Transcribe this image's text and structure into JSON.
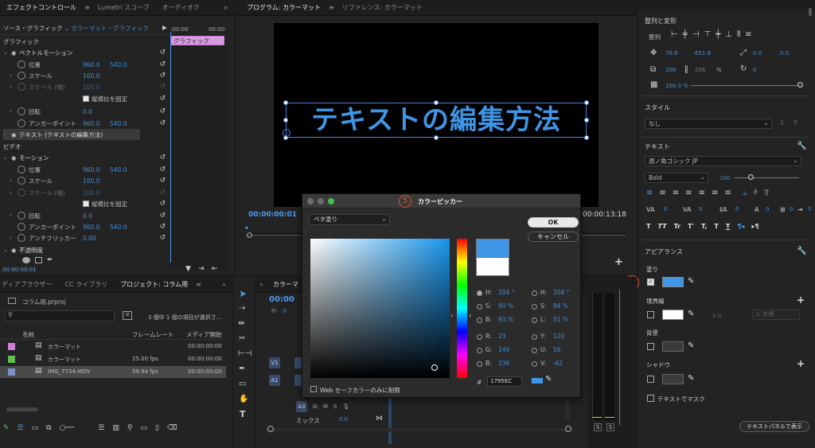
{
  "effect_controls": {
    "tab": "エフェクトコントロール",
    "tab_menu": "≡",
    "tab2": "Lumetri スコープ",
    "tab3": "オーディオク",
    "overflow": "»",
    "source_label": "ソース・グラフィック",
    "source_clip": "カラーマット・グラフィック",
    "timecode_start": ":00:00",
    "timecode_mid": "00:00",
    "clip_label": "グラフィック",
    "rows": [
      {
        "label": "グラフィック",
        "type": "section"
      },
      {
        "label": "ベクトルモーション",
        "type": "group"
      },
      {
        "label": "位置",
        "v1": "960.0",
        "v2": "540.0"
      },
      {
        "label": "スケール",
        "v1": "100.0"
      },
      {
        "label": "スケール (幅)",
        "v1": "100.0",
        "disabled": true
      },
      {
        "label": "縦横比を固定",
        "type": "checkbox"
      },
      {
        "label": "回転",
        "v1": "0.0"
      },
      {
        "label": "アンカーポイント",
        "v1": "960.0",
        "v2": "540.0"
      },
      {
        "label": "テキスト (テキストの編集方法)",
        "type": "group-selected"
      },
      {
        "label": "ビデオ",
        "type": "section"
      },
      {
        "label": "モーション",
        "type": "group"
      },
      {
        "label": "位置",
        "v1": "960.0",
        "v2": "540.0"
      },
      {
        "label": "スケール",
        "v1": "100.0"
      },
      {
        "label": "スケール (幅)",
        "v1": "100.0",
        "disabled": true
      },
      {
        "label": "縦横比を固定",
        "type": "checkbox"
      },
      {
        "label": "回転",
        "v1": "0.0"
      },
      {
        "label": "アンカーポイント",
        "v1": "960.0",
        "v2": "540.0"
      },
      {
        "label": "アンチフリッカー",
        "v1": "0.00"
      },
      {
        "label": "不透明度",
        "type": "group"
      }
    ],
    "bottom_timecode": "00:00:00:01"
  },
  "program": {
    "tab": "プログラム: カラーマット",
    "tab_menu": "≡",
    "tab2": "リファレンス: カラーマット",
    "overflow": "»",
    "title_text": "テキストの編集方法",
    "timecode_left": "00:00:00:01",
    "timecode_right": "00:00:13:18",
    "plus": "+"
  },
  "project": {
    "tab1": "ディアブラウザー",
    "tab2": "CC ライブラリ",
    "tab3": "プロジェクト: コラム用",
    "tab_menu": "≡",
    "overflow": "»",
    "file": "コラム用.prproj",
    "count": "3 個中 1 個の項目が選択さ...",
    "columns": [
      "名前",
      "フレームレート",
      "メディア開始"
    ],
    "items": [
      {
        "name": "カラーマット",
        "fps": "",
        "start": "00:00:00:00",
        "color": "#d27fdc"
      },
      {
        "name": "カラーマット",
        "fps": "25.00 fps",
        "start": "00:00:00:00",
        "color": "#5fbf4e"
      },
      {
        "name": "IMG_7734.MOV",
        "fps": "59.94 fps",
        "start": "00:00:00:00",
        "color": "#7c93c9"
      }
    ]
  },
  "timeline": {
    "tab": "カラーマ",
    "overflow": "»",
    "timecode": "00:00",
    "tracks": [
      "V1",
      "A1",
      "A3"
    ],
    "mix_label": "ミックス",
    "mix_value": "0.0",
    "s_labels": [
      "S",
      "S"
    ]
  },
  "color_picker": {
    "title": "カラーピッカー",
    "fill_type": "ベタ塗り",
    "ok": "OK",
    "cancel": "キャンセル",
    "h1_label": "H:",
    "h1": "204 °",
    "s1_label": "S:",
    "s1": "90 %",
    "b1_label": "B:",
    "b1": "93 %",
    "r_label": "R:",
    "r": "23",
    "g_label": "G:",
    "g": "149",
    "b_label": "B:",
    "b": "236",
    "h2_label": "H:",
    "h2": "204 °",
    "s2_label": "S:",
    "s2": "84 %",
    "l_label": "L:",
    "l": "51 %",
    "y_label": "Y:",
    "y": "120",
    "u_label": "U:",
    "u": "56",
    "v_label": "V:",
    "v": "-62",
    "hex_label": "#",
    "hex": "1795EC",
    "websafe": "Web セーフカラーのみに制限",
    "step_number": "5",
    "new_color": "#3f95e6",
    "old_color": "#ffffff"
  },
  "essential": {
    "align_header": "整列と変形",
    "align_label": "整列",
    "pos_x": "76.6",
    "pos_y": "651.8",
    "anchor_x": "0.0",
    "anchor_y": "0.0",
    "w": "206",
    "h": "206",
    "pct": "%",
    "rotation": "0",
    "opacity": "100.0 %",
    "style_header": "スタイル",
    "style_value": "なし",
    "text_header": "テキスト",
    "font": "源ノ角ゴシック JP",
    "weight": "Bold",
    "size": "100",
    "kerning": [
      "0",
      "0",
      "0",
      "0",
      "0",
      "0"
    ],
    "caps": [
      "T",
      "TT",
      "Tr",
      "T'",
      "T,",
      "T",
      "T"
    ],
    "appearance_header": "アピアランス",
    "fill_label": "塗り",
    "fill_color": "#3f95e6",
    "stroke_label": "境界線",
    "stroke_width": "4.0",
    "stroke_type": "外側",
    "bg_label": "背景",
    "shadow_label": "シャドウ",
    "mask_label": "テキストでマスク",
    "bottom_button": "テキストパネルで表示",
    "step_number": "4",
    "plus": "+"
  }
}
